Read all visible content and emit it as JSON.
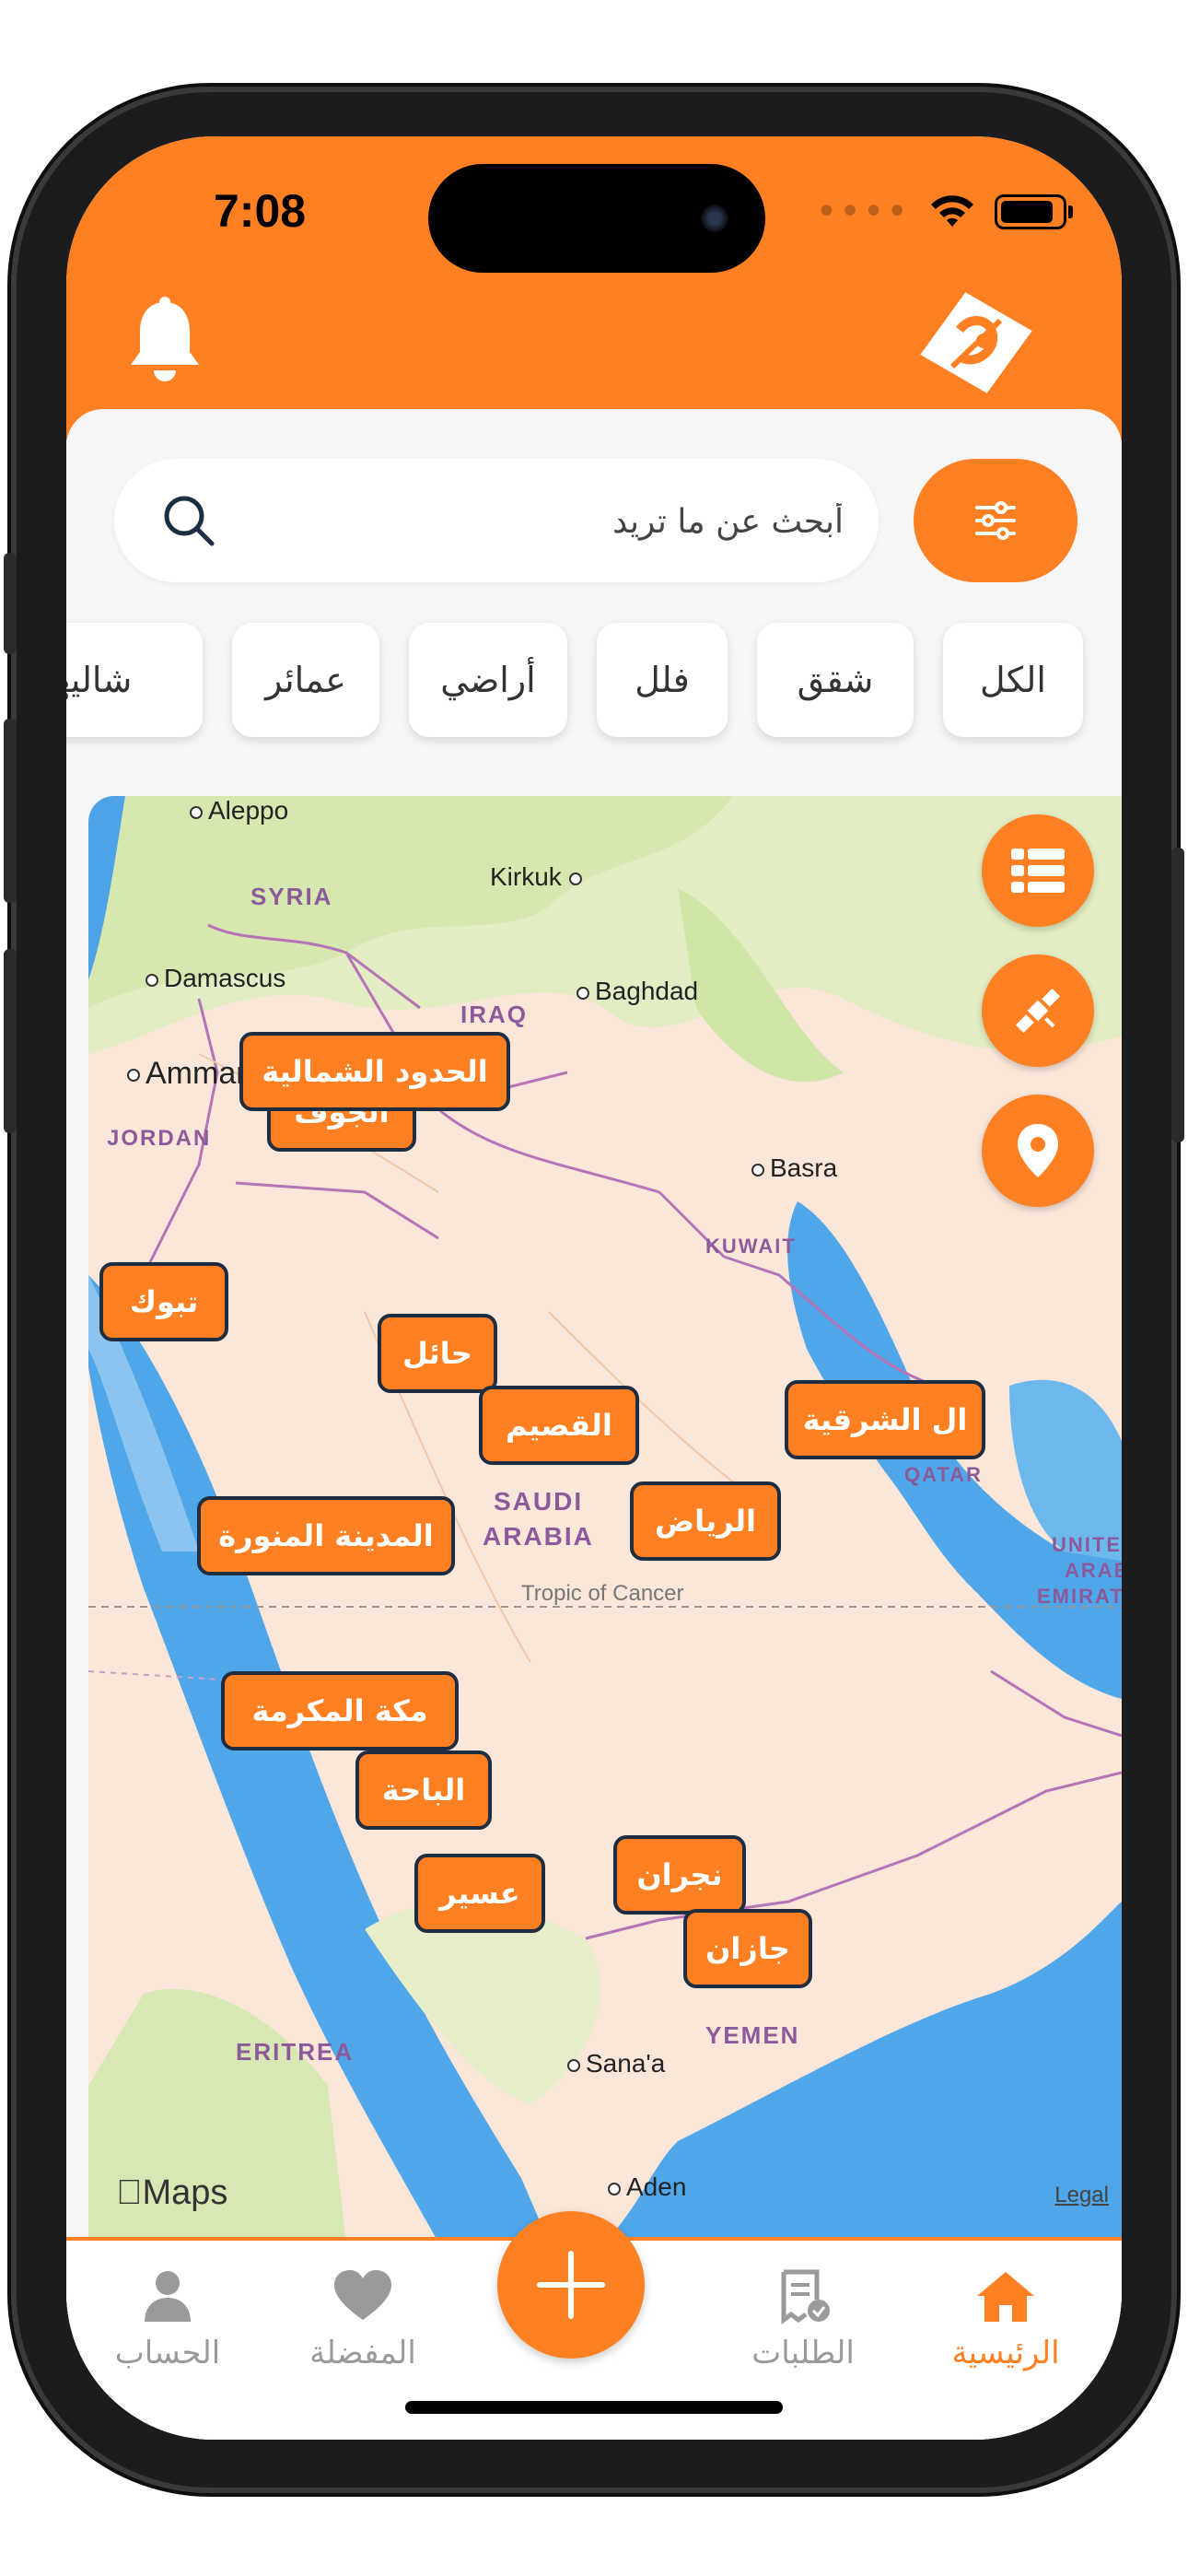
{
  "status_bar": {
    "time": "7:08"
  },
  "header": {
    "bell_icon": "bell-icon",
    "logo_icon": "app-logo-icon",
    "accent_color": "#ff8022",
    "border_color": "#1f2d40"
  },
  "search": {
    "placeholder": "أبحث عن ما تريد",
    "value": ""
  },
  "categories": [
    {
      "label": "الكل"
    },
    {
      "label": "شقق"
    },
    {
      "label": "فلل"
    },
    {
      "label": "أراضي"
    },
    {
      "label": "عمائر"
    },
    {
      "label": "شاليهات"
    }
  ],
  "map": {
    "credit": "Maps",
    "legal": "Legal",
    "tropic_label": "Tropic of Cancer",
    "cities": [
      {
        "name": "Aleppo"
      },
      {
        "name": "Kirkuk"
      },
      {
        "name": "Damascus"
      },
      {
        "name": "Baghdad"
      },
      {
        "name": "Amman"
      },
      {
        "name": "Basra"
      },
      {
        "name": "Sana'a"
      },
      {
        "name": "Aden"
      }
    ],
    "countries": [
      {
        "name": "SYRIA"
      },
      {
        "name": "IRAQ"
      },
      {
        "name": "JORDAN"
      },
      {
        "name": "KUWAIT"
      },
      {
        "name": "SAUDI"
      },
      {
        "name": "ARABIA"
      },
      {
        "name": "QATAR"
      },
      {
        "name": "ERITREA"
      },
      {
        "name": "YEMEN"
      },
      {
        "name": "UNITE"
      },
      {
        "name": "ARAB"
      },
      {
        "name": "EMIRAT"
      }
    ],
    "regions": [
      {
        "label": "الحدود الشمالية"
      },
      {
        "label": "الجوف"
      },
      {
        "label": "تبوك"
      },
      {
        "label": "حائل"
      },
      {
        "label": "القصيم"
      },
      {
        "label": "ال الشرقية"
      },
      {
        "label": "الرياض"
      },
      {
        "label": "المدينة المنورة"
      },
      {
        "label": "مكة المكرمة"
      },
      {
        "label": "الباحة"
      },
      {
        "label": "عسير"
      },
      {
        "label": "نجران"
      },
      {
        "label": "جازان"
      }
    ]
  },
  "map_controls": {
    "list_icon": "list-icon",
    "satellite_icon": "satellite-icon",
    "location_icon": "location-pin-icon"
  },
  "tabs": [
    {
      "label": "الرئيسية",
      "icon": "home-icon",
      "active": true
    },
    {
      "label": "الطلبات",
      "icon": "orders-receipt-icon",
      "active": false
    },
    {
      "label": "المفضلة",
      "icon": "heart-icon",
      "active": false
    },
    {
      "label": "الحساب",
      "icon": "person-icon",
      "active": false
    }
  ],
  "add_button": {
    "icon": "plus-icon"
  }
}
